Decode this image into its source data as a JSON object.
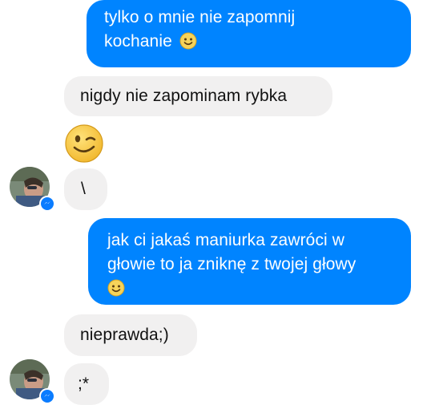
{
  "conversation": {
    "messages": [
      {
        "sender": "me",
        "text": "tylko o mnie nie zapomnij kochanie",
        "emoji": "smile-emoji"
      },
      {
        "sender": "contact",
        "text": "nigdy nie zapominam rybka"
      },
      {
        "sender": "contact",
        "emoji": "wink-emoji"
      },
      {
        "sender": "contact",
        "text": "\\"
      },
      {
        "sender": "me",
        "text": "jak ci jakaś maniurka zawróci w głowie to ja zniknę z twojej głowy",
        "emoji": "smile-emoji"
      },
      {
        "sender": "contact",
        "text": "nieprawda;)"
      },
      {
        "sender": "contact",
        "text": ";*"
      }
    ]
  },
  "lines": {
    "m1_line1": "tylko o mnie nie zapomnij",
    "m1_line2": "kochanie",
    "m5_line1": "jak ci jakaś maniurka zawróci w",
    "m5_line2": "głowie to ja zniknę z twojej głowy"
  },
  "colors": {
    "outgoing_bubble": "#0084ff",
    "incoming_bubble": "#f1f0f0",
    "messenger_badge": "#0a7cff"
  },
  "icons": {
    "avatar_badge": "messenger-icon"
  }
}
